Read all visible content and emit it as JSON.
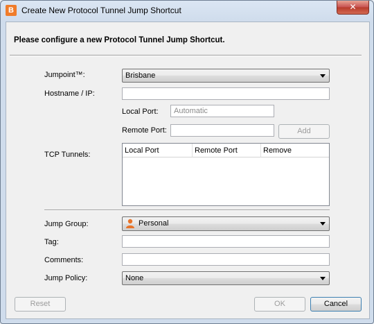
{
  "window": {
    "title": "Create New Protocol Tunnel Jump Shortcut",
    "app_icon_letter": "B",
    "close_glyph": "✕"
  },
  "header": "Please configure a new Protocol Tunnel Jump Shortcut.",
  "form": {
    "jumpoint_label": "Jumpoint™:",
    "jumpoint_value": "Brisbane",
    "hostname_label": "Hostname / IP:",
    "hostname_value": "",
    "local_port_label": "Local Port:",
    "local_port_placeholder": "Automatic",
    "remote_port_label": "Remote Port:",
    "remote_port_value": "",
    "add_label": "Add",
    "tcp_tunnels_label": "TCP Tunnels:",
    "tunnels_columns": [
      "Local Port",
      "Remote Port",
      "Remove"
    ],
    "jump_group_label": "Jump Group:",
    "jump_group_value": "Personal",
    "tag_label": "Tag:",
    "tag_value": "",
    "comments_label": "Comments:",
    "comments_value": "",
    "jump_policy_label": "Jump Policy:",
    "jump_policy_value": "None"
  },
  "buttons": {
    "reset": "Reset",
    "ok": "OK",
    "cancel": "Cancel"
  }
}
